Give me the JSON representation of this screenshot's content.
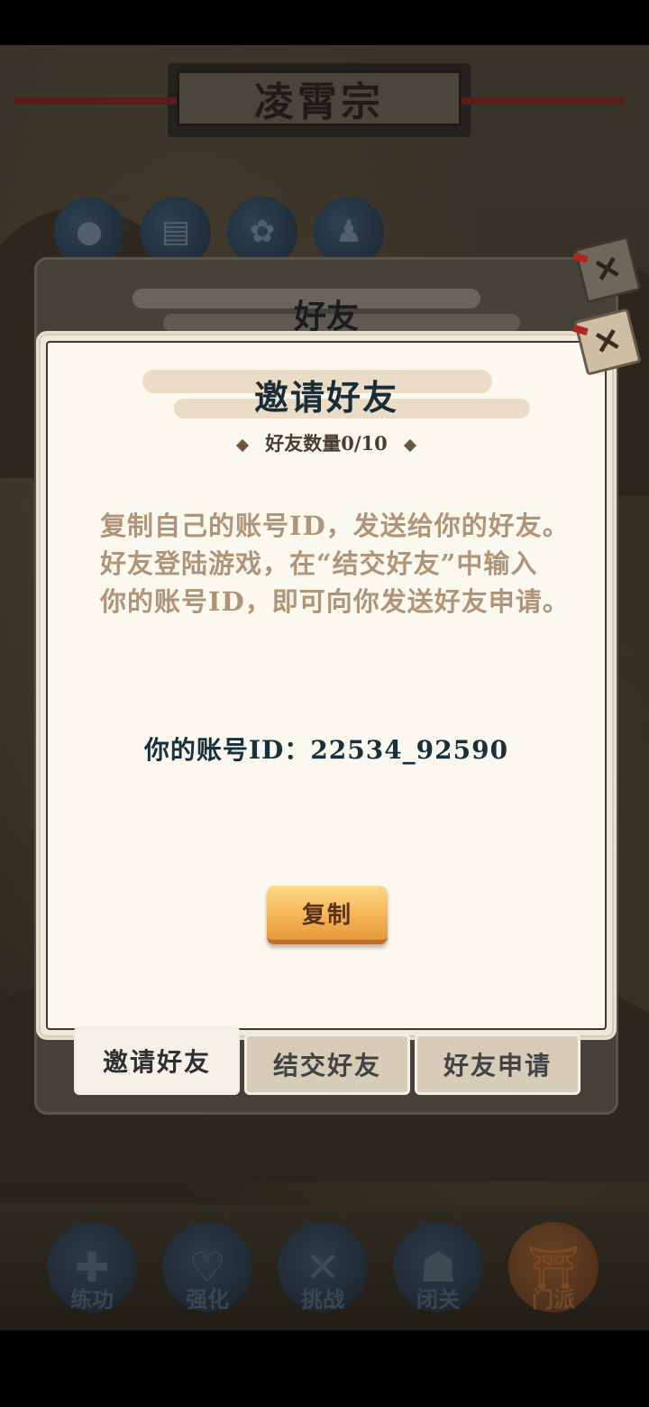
{
  "background": {
    "sect_title": "凌霄宗",
    "top_icons": [
      "bag-icon",
      "scroll-icon",
      "lotus-icon",
      "people-icon"
    ],
    "bottom_nav": [
      {
        "label": "练功",
        "icon": "training-icon"
      },
      {
        "label": "强化",
        "icon": "heart-mind-icon"
      },
      {
        "label": "挑战",
        "icon": "crossed-swords-icon"
      },
      {
        "label": "闭关",
        "icon": "meditation-icon"
      },
      {
        "label": "门派",
        "icon": "gate-icon",
        "active": true
      }
    ]
  },
  "back_dialog": {
    "title": "好友"
  },
  "dialog": {
    "title": "邀请好友",
    "friend_count_label": "好友数量0/10",
    "description_lines": [
      "复制自己的账号ID，发送给你的好友。",
      "好友登陆游戏，在“结交好友”中输入",
      "你的账号ID，即可向你发送好友申请。"
    ],
    "account_line": "你的账号ID：22534_92590",
    "copy_button": "复制"
  },
  "tabs": [
    {
      "label": "邀请好友",
      "active": true
    },
    {
      "label": "结交好友",
      "active": false
    },
    {
      "label": "好友申请",
      "active": false
    }
  ],
  "close_icon_glyph": "✕",
  "colors": {
    "accent_button": "#f5b556",
    "title_text": "#1a2d35",
    "description_text": "#b09479",
    "paper": "#fbf8f0"
  }
}
